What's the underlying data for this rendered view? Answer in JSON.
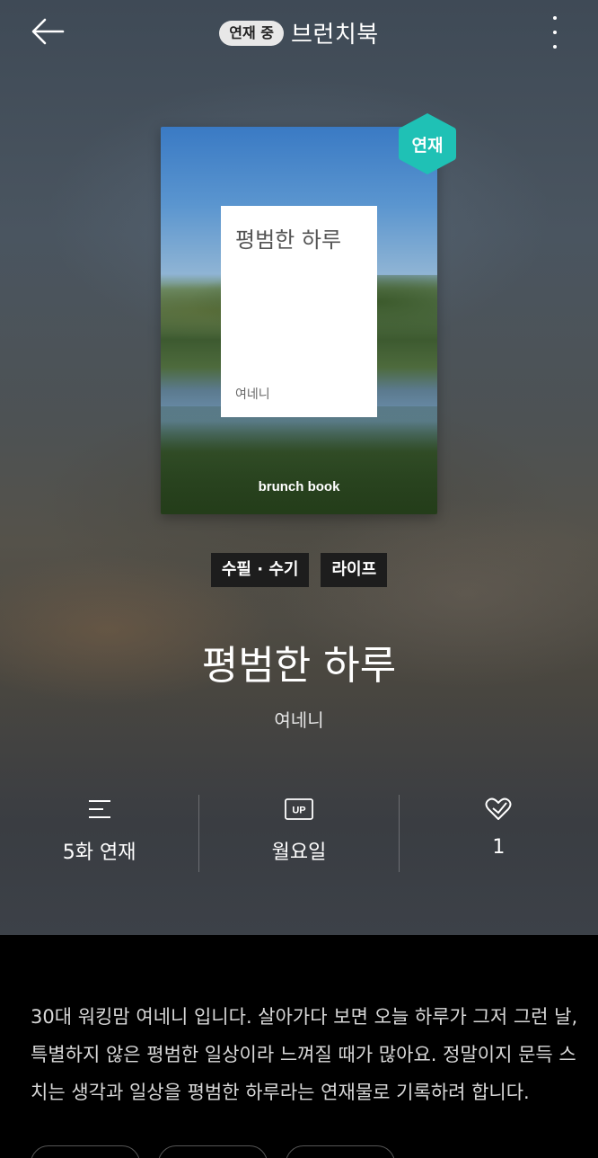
{
  "header": {
    "status": "연재 중",
    "brand": "브런치북"
  },
  "cover": {
    "title": "평범한 하루",
    "author": "여네니",
    "brand": "brunch book",
    "badge": "연재",
    "badge_color": "#1fc1b5"
  },
  "tags": [
    "수필 · 수기",
    "라이프"
  ],
  "book": {
    "title": "평범한 하루",
    "author": "여네니"
  },
  "stats": [
    {
      "icon": "list-icon",
      "value": "5화 연재"
    },
    {
      "icon": "update-day-icon",
      "icon_text": "UP",
      "value": "월요일"
    },
    {
      "icon": "heart-icon",
      "value": "1"
    }
  ],
  "description": "30대 워킹맘 여네니 입니다. 살아가다 보면 오늘 하루가 그저 그런 날, 특별하지 않은 평범한 일상이라 느껴질 때가 많아요. 정말이지 문득 스치는 생각과 일상을 평범한 하루라는 연재물로 기록하려 합니다."
}
